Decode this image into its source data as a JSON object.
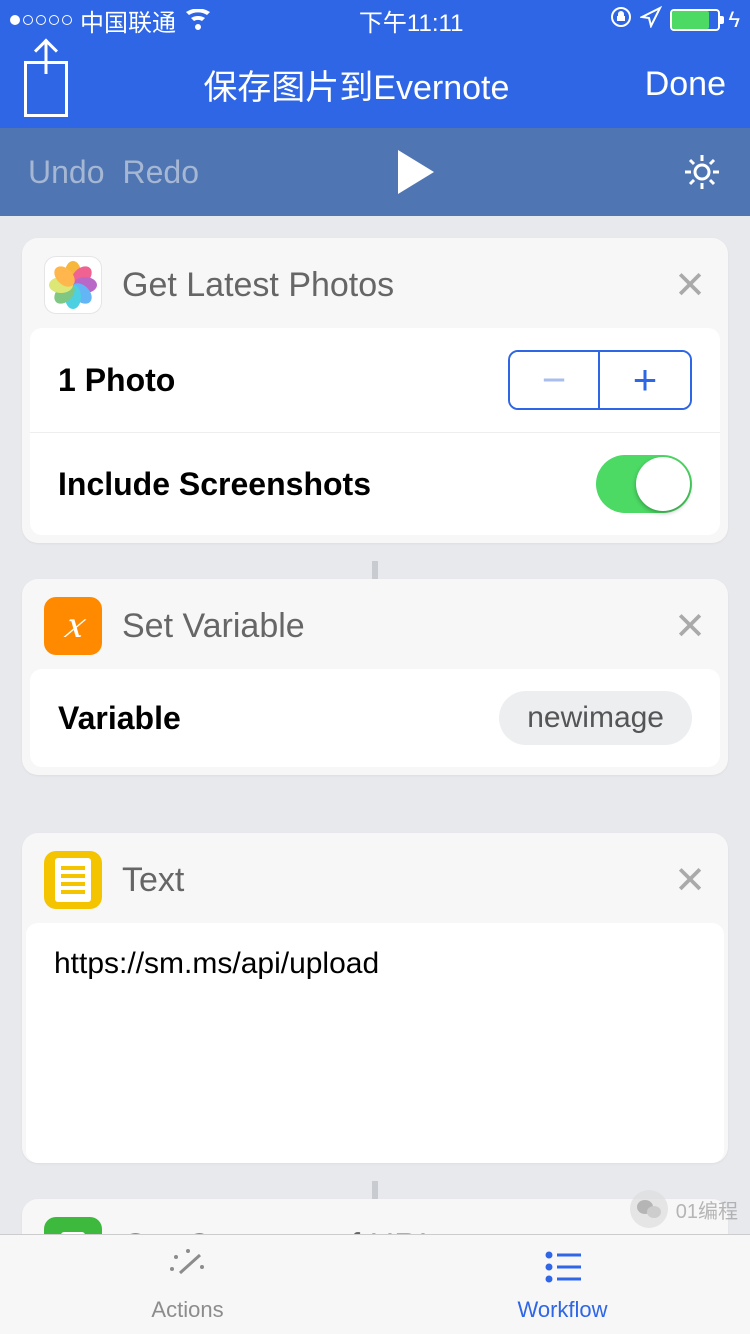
{
  "status": {
    "carrier": "中国联通",
    "time": "下午11:11"
  },
  "nav": {
    "title": "保存图片到Evernote",
    "done": "Done"
  },
  "toolbar": {
    "undo": "Undo",
    "redo": "Redo"
  },
  "actions": [
    {
      "title": "Get Latest Photos",
      "row1_label": "1 Photo",
      "row2_label": "Include Screenshots"
    },
    {
      "title": "Set Variable",
      "row1_label": "Variable",
      "value": "newimage"
    },
    {
      "title": "Text",
      "text_value": "https://sm.ms/api/upload"
    },
    {
      "title": "Get Contents of URL"
    }
  ],
  "tabs": {
    "actions": "Actions",
    "workflow": "Workflow"
  },
  "watermark": "01编程"
}
